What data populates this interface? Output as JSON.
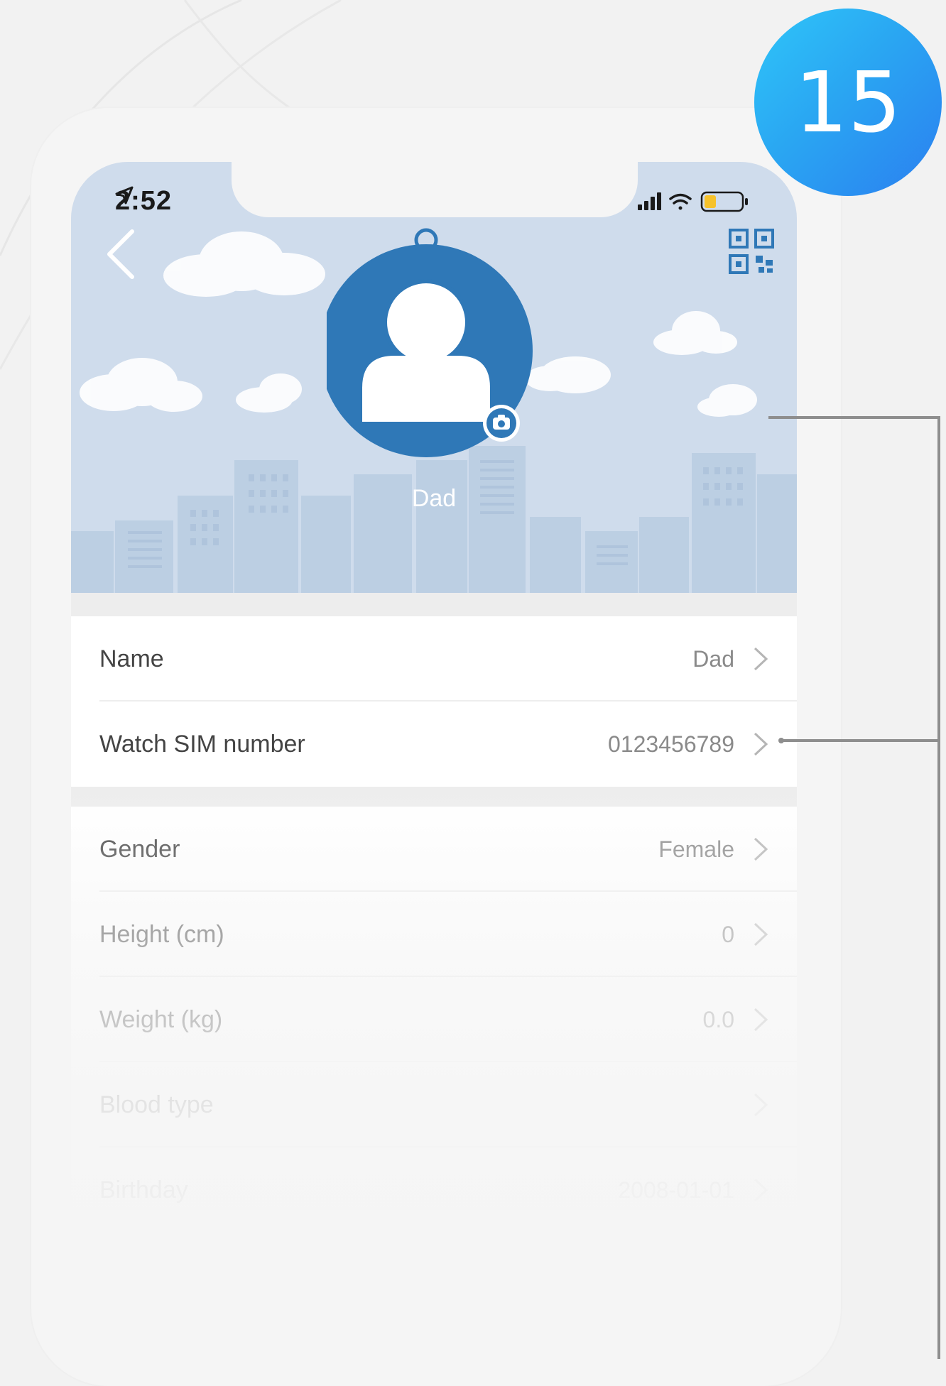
{
  "badge": {
    "number": "15"
  },
  "status_bar": {
    "time": "2:52"
  },
  "profile": {
    "name": "Dad"
  },
  "settings_group_1": [
    {
      "label": "Name",
      "value": "Dad"
    },
    {
      "label": "Watch SIM number",
      "value": "0123456789"
    }
  ],
  "settings_group_2": [
    {
      "label": "Gender",
      "value": "Female"
    },
    {
      "label": "Height (cm)",
      "value": "0"
    },
    {
      "label": "Weight (kg)",
      "value": "0.0"
    },
    {
      "label": "Blood type",
      "value": ""
    },
    {
      "label": "Birthday",
      "value": "2008-01-01"
    }
  ],
  "colors": {
    "header_bg": "#cfdcec",
    "avatar_blue": "#2f78b7",
    "badge_gradient_start": "#2fc6f9",
    "badge_gradient_end": "#2b7ff0",
    "battery": "#f6c22b"
  },
  "icons": [
    "back-chevron-icon",
    "qr-code-icon",
    "camera-icon",
    "location-arrow-icon",
    "signal-icon",
    "wifi-icon",
    "battery-icon",
    "chevron-right-icon"
  ]
}
